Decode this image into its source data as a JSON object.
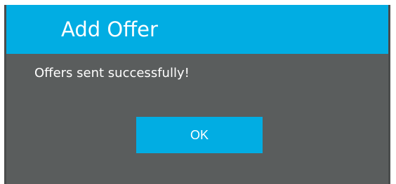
{
  "dialog": {
    "title": "Add Offer",
    "message": "Offers sent successfully!",
    "ok_label": "OK"
  },
  "colors": {
    "accent": "#01ade3",
    "dialog_background": "#5a5d5d",
    "text": "#ffffff"
  }
}
